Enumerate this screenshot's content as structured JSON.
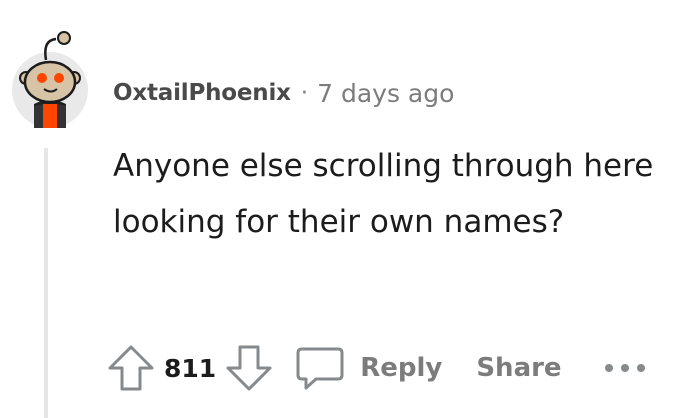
{
  "comment": {
    "username": "OxtailPhoenix",
    "separator": "·",
    "timestamp": "7 days ago",
    "body": "Anyone else scrolling through here looking for their own names?",
    "vote_count": "811",
    "avatar_icon": "snoo-avatar-icon"
  },
  "actions": {
    "upvote_icon": "arrow-up-icon",
    "downvote_icon": "arrow-down-icon",
    "reply_icon": "speech-bubble-icon",
    "reply_label": "Reply",
    "share_label": "Share",
    "more_icon": "ellipsis-icon"
  },
  "colors": {
    "text_primary": "#1c1c1c",
    "text_meta": "#7c7c7c",
    "thread_line": "#e6e6e6",
    "avatar_accent": "#ff4500"
  }
}
